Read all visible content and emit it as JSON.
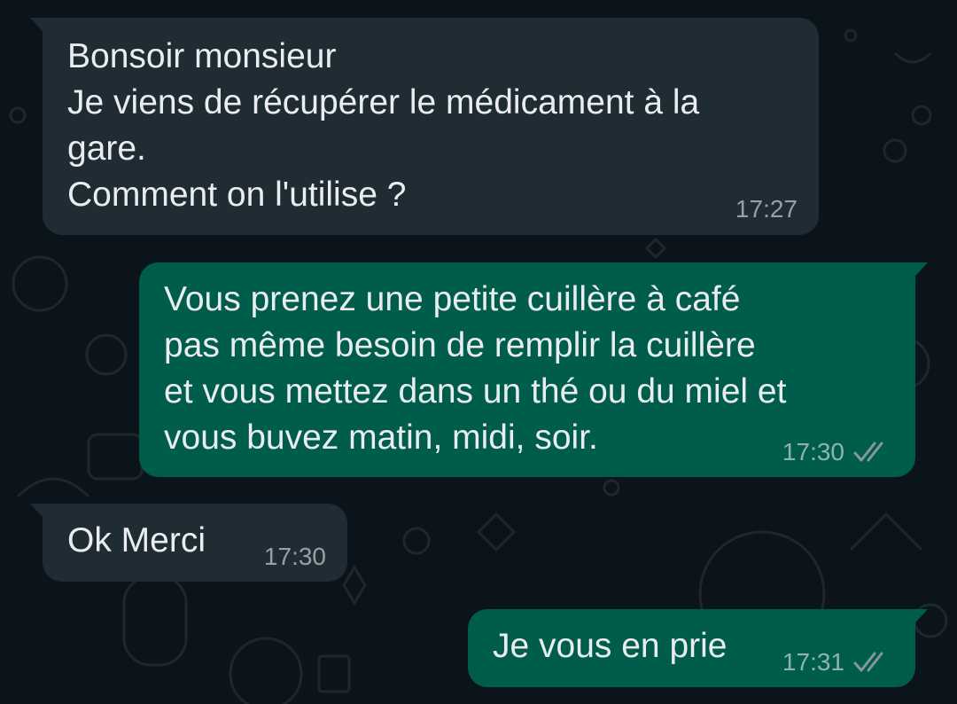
{
  "messages": [
    {
      "direction": "incoming",
      "lines": [
        "Bonsoir monsieur",
        "Je viens de récupérer le médicament à la",
        "gare.",
        "Comment on l'utilise ?"
      ],
      "time": "17:27"
    },
    {
      "direction": "outgoing",
      "lines": [
        "Vous prenez une petite cuillère à café",
        "pas même besoin de remplir la cuillère",
        "et vous mettez dans un thé ou du miel et",
        "vous buvez matin, midi, soir."
      ],
      "time": "17:30",
      "status_icon": "double-check-icon"
    },
    {
      "direction": "incoming",
      "lines": [
        "Ok Merci"
      ],
      "time": "17:30"
    },
    {
      "direction": "outgoing",
      "lines": [
        "Je vous en prie"
      ],
      "time": "17:31",
      "status_icon": "double-check-icon"
    }
  ],
  "colors": {
    "background": "#0b141a",
    "incoming_bubble": "#1f2c34",
    "outgoing_bubble": "#005c4b",
    "text": "#e9edef"
  }
}
